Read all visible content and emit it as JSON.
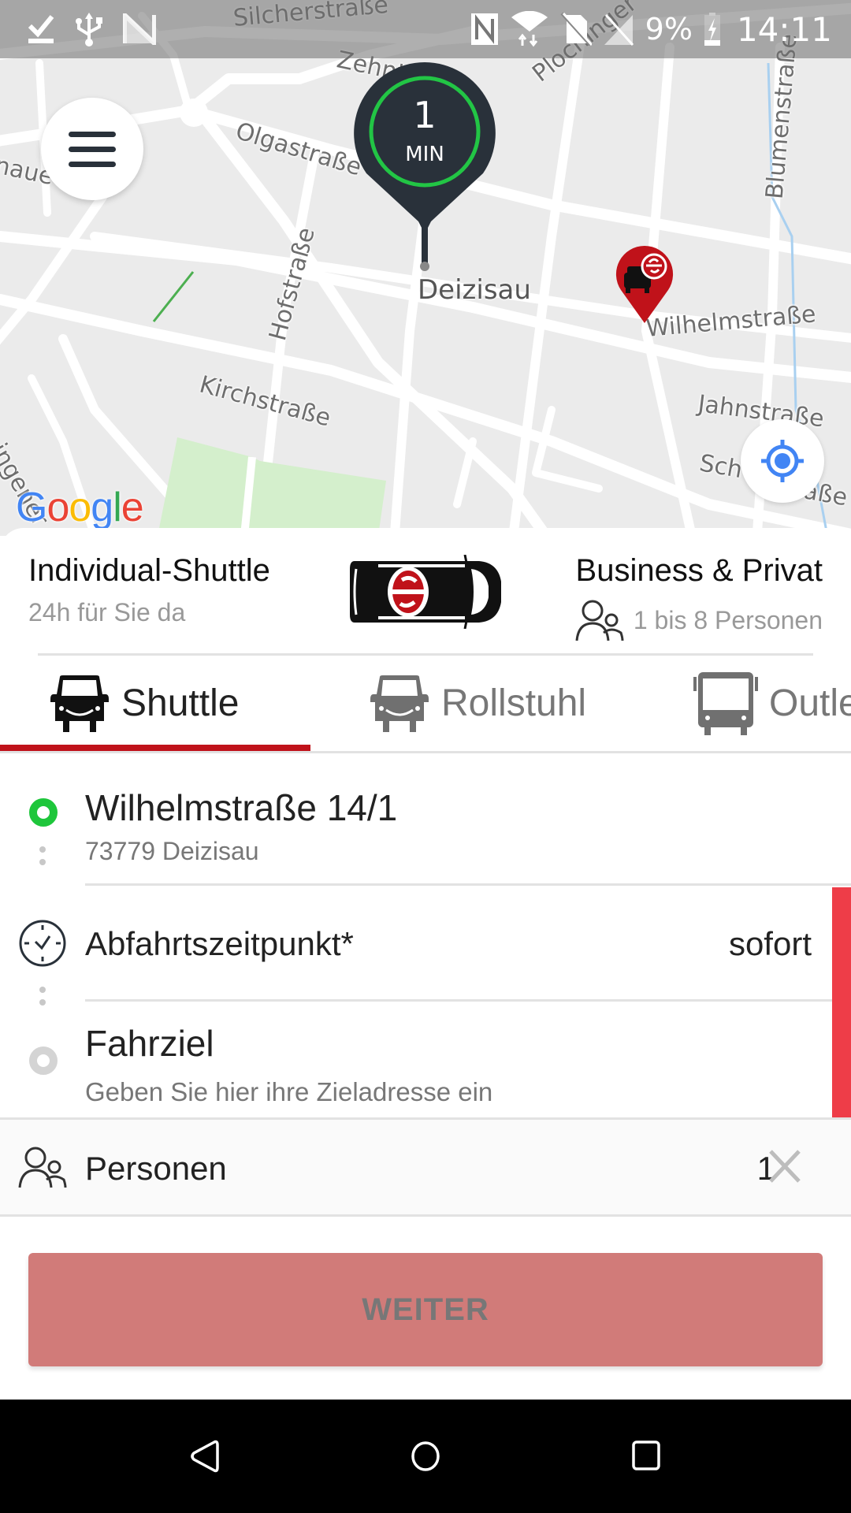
{
  "status_bar": {
    "left_icons": [
      "download-done-icon",
      "usb-icon",
      "app-notification-icon"
    ],
    "right_icons": [
      "nfc-icon",
      "wifi-icon",
      "no-sim-icon",
      "no-signal-icon"
    ],
    "battery_percent": "9%",
    "battery_icon": "battery-charging-icon",
    "time": "14:11"
  },
  "map": {
    "provider_logo": "Google",
    "city_label": "Deizisau",
    "street_labels": [
      "Silcherstraße",
      "Zehnt",
      "Plochinger",
      "Olgastraße",
      "Hofstraße",
      "Blumenstraße",
      "Wilhelmstraße",
      "Kirchstraße",
      "Jahnstraße",
      "Sch",
      "aße",
      "naue",
      "ingener"
    ],
    "eta_pin": {
      "value": "1",
      "unit": "MIN"
    },
    "vehicle_marker": "vehicle-location-marker",
    "menu_icon": "hamburger-menu-icon",
    "locate_icon": "my-location-icon"
  },
  "service_info": {
    "title": "Individual-Shuttle",
    "subtitle": "24h für Sie da",
    "right_title": "Business & Privat",
    "right_subtitle": "1 bis 8 Personen"
  },
  "tabs": [
    {
      "label": "Shuttle",
      "icon": "van-icon",
      "active": true
    },
    {
      "label": "Rollstuhl",
      "icon": "van-icon",
      "active": false
    },
    {
      "label": "Outlet",
      "icon": "bus-icon",
      "active": false
    }
  ],
  "form": {
    "origin": {
      "street": "Wilhelmstraße 14/1",
      "city": "73779 Deizisau"
    },
    "departure": {
      "label": "Abfahrtszeitpunkt*",
      "value": "sofort"
    },
    "destination": {
      "label": "Fahrziel",
      "placeholder": "Geben Sie hier ihre Zieladresse ein"
    },
    "persons": {
      "label": "Personen",
      "value": "1"
    }
  },
  "next_button": {
    "label": "WEITER",
    "enabled": false
  },
  "colors": {
    "brand_red": "#c0121a",
    "required_marker": "#ee3d48",
    "origin_dot": "#1ec63b",
    "eta_ring": "#22c545",
    "button_disabled": "#d17b79",
    "locate_blue": "#4285f4"
  }
}
